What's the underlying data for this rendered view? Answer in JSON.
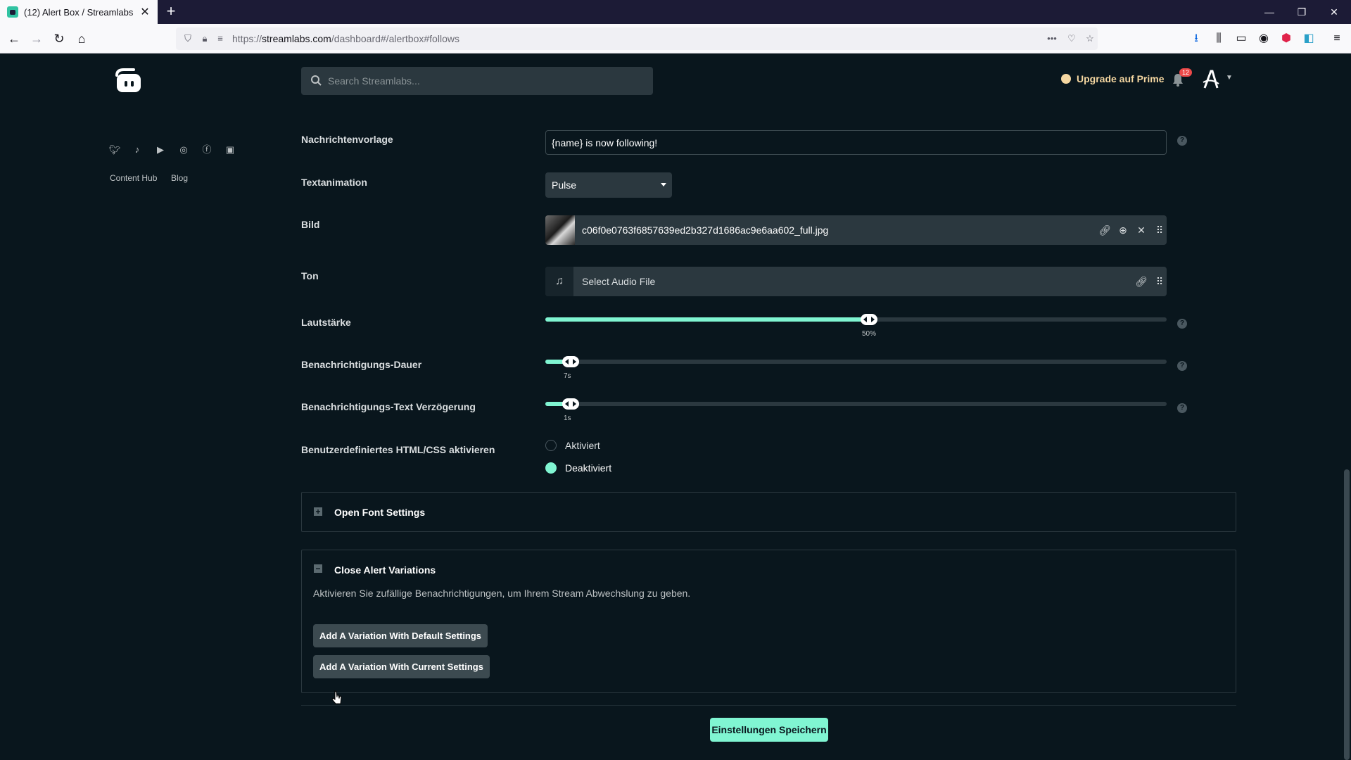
{
  "browser": {
    "tab_title": "(12) Alert Box / Streamlabs",
    "url_prefix": "https://",
    "url_host": "streamlabs.com",
    "url_path": "/dashboard#/alertbox#follows"
  },
  "header": {
    "search_placeholder": "Search Streamlabs...",
    "upgrade_label": "Upgrade auf Prime",
    "notification_count": "12"
  },
  "sidebar": {
    "links": [
      "Content Hub",
      "Blog"
    ],
    "social_icons": [
      "twitter-icon",
      "tiktok-icon",
      "youtube-icon",
      "instagram-icon",
      "facebook-icon",
      "discord-icon"
    ]
  },
  "form": {
    "message_template": {
      "label": "Nachrichtenvorlage",
      "value": "{name} is now following!"
    },
    "text_animation": {
      "label": "Textanimation",
      "value": "Pulse"
    },
    "image": {
      "label": "Bild",
      "file_name": "c06f0e0763f6857639ed2b327d1686ac9e6aa602_full.jpg"
    },
    "sound": {
      "label": "Ton",
      "placeholder": "Select Audio File"
    },
    "volume": {
      "label": "Lautstärke",
      "value_text": "50%",
      "fraction": 0.5
    },
    "alert_duration": {
      "label": "Benachrichtigungs-Dauer",
      "value_text": "7s",
      "fraction": 0.02
    },
    "text_delay": {
      "label": "Benachrichtigungs-Text Verzögerung",
      "value_text": "1s",
      "fraction": 0.02
    },
    "custom_html": {
      "label": "Benutzerdefiniertes HTML/CSS aktivieren",
      "options": [
        "Aktiviert",
        "Deaktiviert"
      ],
      "selected": "Deaktiviert"
    }
  },
  "panels": {
    "font_settings": {
      "title": "Open Font Settings"
    },
    "alert_variations": {
      "title": "Close Alert Variations",
      "description": "Aktivieren Sie zufällige Benachrichtigungen, um Ihrem Stream Abwechslung zu geben.",
      "button_default": "Add A Variation With Default Settings",
      "button_current": "Add A Variation With Current Settings"
    }
  },
  "save_label": "Einstellungen Speichern",
  "colors": {
    "accent": "#80f5d2",
    "background": "#09161d",
    "input": "#2b383f",
    "prime": "#f5d7a1"
  }
}
